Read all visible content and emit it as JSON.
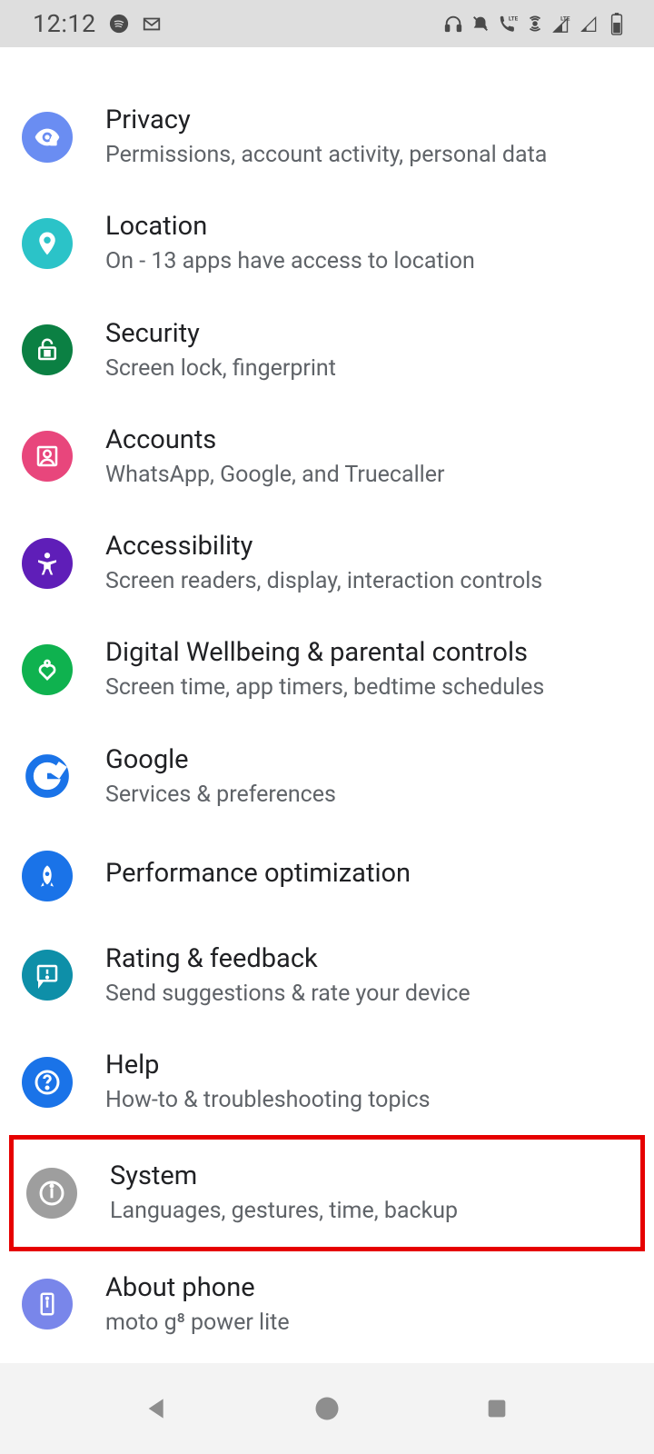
{
  "statusbar": {
    "time": "12:12"
  },
  "settings": {
    "items": [
      {
        "title": "Privacy",
        "subtitle": "Permissions, account activity, personal data",
        "color": "#6a8df2",
        "icon": "eye-lock"
      },
      {
        "title": "Location",
        "subtitle": "On - 13 apps have access to location",
        "color": "#2bc3c8",
        "icon": "pin"
      },
      {
        "title": "Security",
        "subtitle": "Screen lock, fingerprint",
        "color": "#0b8043",
        "icon": "lock-open"
      },
      {
        "title": "Accounts",
        "subtitle": "WhatsApp, Google, and Truecaller",
        "color": "#e8467c",
        "icon": "person-box"
      },
      {
        "title": "Accessibility",
        "subtitle": "Screen readers, display, interaction controls",
        "color": "#5f1eb8",
        "icon": "person"
      },
      {
        "title": "Digital Wellbeing & parental controls",
        "subtitle": "Screen time, app timers, bedtime schedules",
        "color": "#0fb24f",
        "icon": "heart"
      },
      {
        "title": "Google",
        "subtitle": "Services & preferences",
        "color": "#ffffff",
        "icon": "google"
      },
      {
        "title": "Performance optimization",
        "subtitle": "",
        "color": "#1a73e8",
        "icon": "rocket"
      },
      {
        "title": "Rating & feedback",
        "subtitle": "Send suggestions & rate your device",
        "color": "#0e8fa8",
        "icon": "feedback"
      },
      {
        "title": "Help",
        "subtitle": "How-to & troubleshooting topics",
        "color": "#1a73e8",
        "icon": "help"
      },
      {
        "title": "System",
        "subtitle": "Languages, gestures, time, backup",
        "color": "#9e9e9e",
        "icon": "info",
        "highlight": true
      },
      {
        "title": "About phone",
        "subtitle": "moto g⁸ power lite",
        "color": "#7986ea",
        "icon": "phone-info"
      }
    ]
  }
}
